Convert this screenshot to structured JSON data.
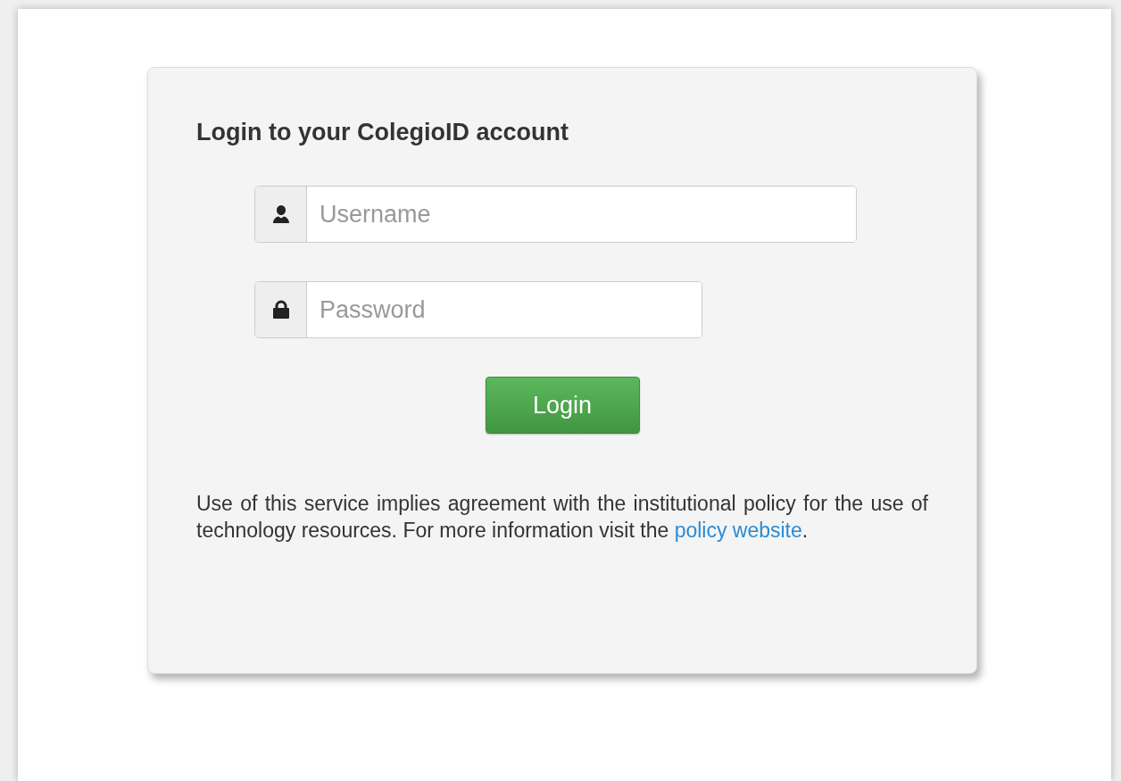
{
  "login_card": {
    "title": "Login to your ColegioID account",
    "fields": [
      {
        "kind": "user",
        "placeholder": "Username"
      },
      {
        "kind": "password",
        "placeholder": "Password"
      }
    ],
    "button": "Login",
    "notice": {
      "text": "Use of this service implies agreement with the institutional policy for the use of technology resources. For more information visit the",
      "link": "policy website",
      "suffix": "."
    }
  }
}
